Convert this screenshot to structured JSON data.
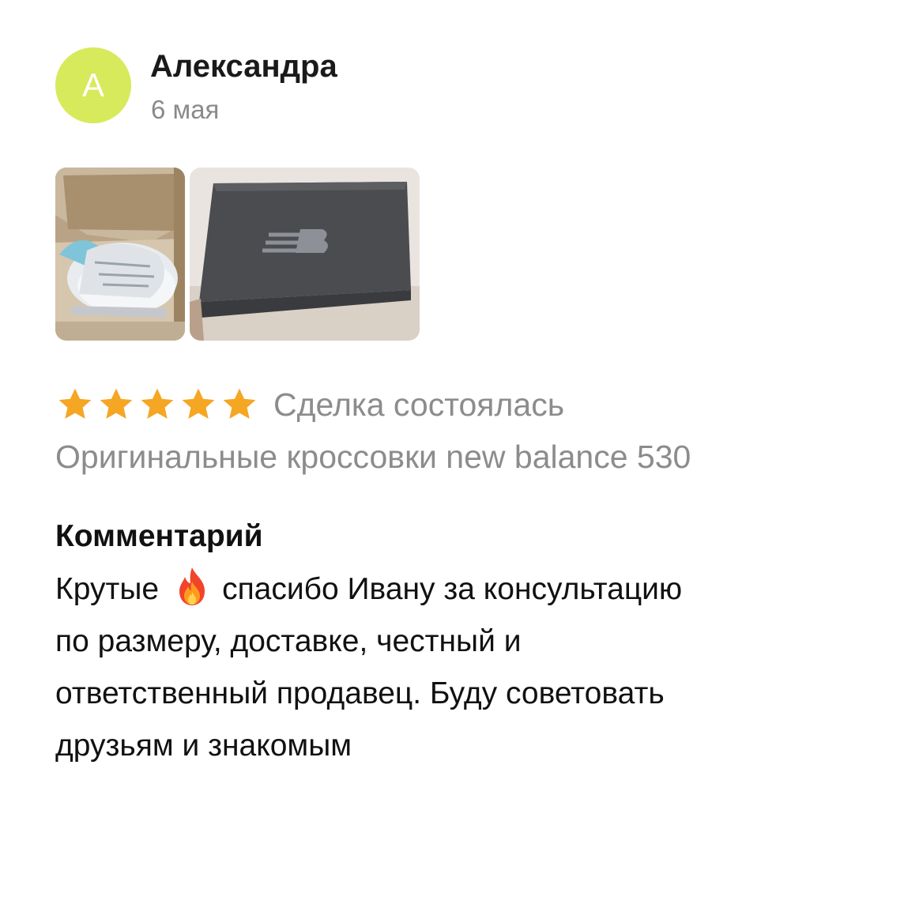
{
  "review": {
    "author": {
      "name": "Александра",
      "avatar_letter": "A",
      "avatar_color": "#d7ea5b"
    },
    "date": "6 мая",
    "photos": [
      {
        "icon": "sneakers-in-box-photo"
      },
      {
        "icon": "shoe-box-photo"
      }
    ],
    "rating": {
      "stars": 5,
      "max": 5,
      "star_color": "#f5a623"
    },
    "deal_status": "Сделка состоялась",
    "product_title": "Оригинальные кроссовки new balance 530",
    "comment": {
      "heading": "Комментарий",
      "line1_before_icon": "Крутые",
      "line1_after_icon": "спасибо Ивану за консультацию",
      "line2": "по размеру, доставке, честный и",
      "line3": "ответственный продавец. Буду советовать",
      "line4": "друзьям и знакомым",
      "emoji": "fire-icon"
    }
  }
}
